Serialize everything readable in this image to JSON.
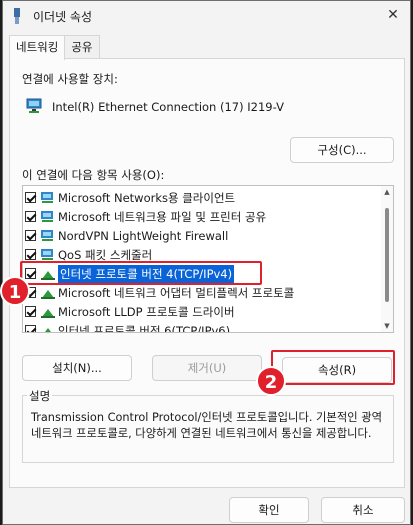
{
  "window": {
    "title": "이더넷 속성",
    "close_glyph": "✕"
  },
  "tabs": [
    {
      "label": "네트워킹"
    },
    {
      "label": "공유"
    }
  ],
  "connect_using_label": "연결에 사용할 장치:",
  "device_name": "Intel(R) Ethernet Connection (17) I219-V",
  "configure_button": "구성(C)...",
  "items_label": "이 연결에 다음 항목 사용(O):",
  "items": [
    {
      "label": "Microsoft Networks용 클라이언트",
      "checked": true,
      "icon": "network-client-icon"
    },
    {
      "label": "Microsoft 네트워크용 파일 및 프린터 공유",
      "checked": true,
      "icon": "network-share-icon"
    },
    {
      "label": "NordVPN LightWeight Firewall",
      "checked": true,
      "icon": "network-service-icon"
    },
    {
      "label": "QoS 패킷 스케줄러",
      "checked": true,
      "icon": "network-service-icon"
    },
    {
      "label": "인터넷 프로토콜 버전 4(TCP/IPv4)",
      "checked": true,
      "icon": "protocol-icon",
      "selected": true
    },
    {
      "label": "Microsoft 네트워크 어댑터 멀티플렉서 프로토콜",
      "checked": false,
      "icon": "protocol-icon"
    },
    {
      "label": "Microsoft LLDP 프로토콜 드라이버",
      "checked": true,
      "icon": "protocol-icon"
    },
    {
      "label": "인터넷 프로토콜 버전 6(TCP/IPv6)",
      "checked": true,
      "icon": "protocol-icon"
    }
  ],
  "buttons": {
    "install": "설치(N)...",
    "remove": "제거(U)",
    "properties": "속성(R)"
  },
  "description": {
    "title": "설명",
    "text": "Transmission Control Protocol/인터넷 프로토콜입니다. 기본적인 광역 네트워크 프로토콜로, 다양하게 연결된 네트워크에서 통신을 제공합니다."
  },
  "footer": {
    "ok": "확인",
    "cancel": "취소"
  },
  "annotations": [
    {
      "number": "1"
    },
    {
      "number": "2"
    }
  ],
  "colors": {
    "highlight": "#e0212b",
    "selection": "#0a64d8"
  }
}
